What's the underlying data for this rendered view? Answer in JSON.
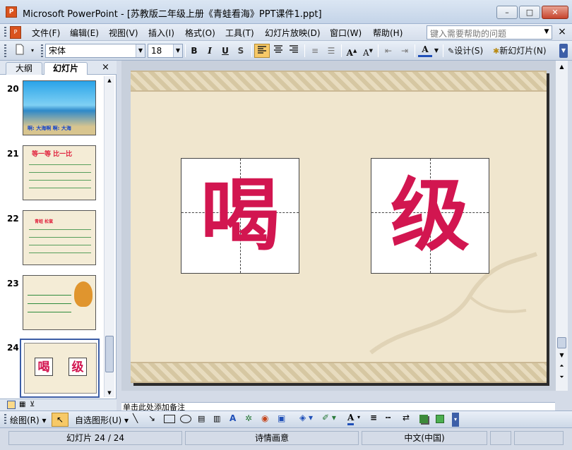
{
  "window": {
    "title": "Microsoft PowerPoint - [苏教版二年级上册《青蛙看海》PPT课件1.ppt]",
    "app_icon_text": "P",
    "min_symbol": "–",
    "max_symbol": "□",
    "close_symbol": "✕"
  },
  "menu": {
    "items": [
      "文件(F)",
      "编辑(E)",
      "视图(V)",
      "插入(I)",
      "格式(O)",
      "工具(T)",
      "幻灯片放映(D)",
      "窗口(W)",
      "帮助(H)"
    ],
    "help_placeholder": "键入需要帮助的问题",
    "close_symbol": "×"
  },
  "toolbar": {
    "font_name": "宋体",
    "font_size": "18",
    "bold": "B",
    "italic": "I",
    "underline": "U",
    "shadow": "S",
    "font_color_label": "A",
    "design_label": "设计(S)",
    "new_slide_label": "新幻灯片(N)"
  },
  "left_panel": {
    "tabs": [
      "大纲",
      "幻灯片"
    ],
    "close_symbol": "×",
    "slides": [
      {
        "number": "20",
        "caption": "啊: 大海啊      啊: 大海"
      },
      {
        "number": "21",
        "caption": "等一等 比一比"
      },
      {
        "number": "22",
        "caption": "青蛙 松鼠"
      },
      {
        "number": "23",
        "caption": ""
      },
      {
        "number": "24",
        "caption": ""
      }
    ],
    "thumb24_chars": [
      "喝",
      "级"
    ]
  },
  "slide": {
    "characters": [
      "喝",
      "级"
    ],
    "accent_color": "#d21650"
  },
  "notes": {
    "placeholder": "单击此处添加备注"
  },
  "drawing_toolbar": {
    "draw_label": "绘图(R)",
    "autoshape_label": "自选图形(U)"
  },
  "status": {
    "slide_info": "幻灯片 24 / 24",
    "design": "诗情画意",
    "language": "中文(中国)"
  },
  "icons": {
    "new_doc": "new-document-icon",
    "align_left": "align-left-icon",
    "align_center": "align-center-icon",
    "align_right": "align-right-icon",
    "numbering": "numbering-icon",
    "bullets": "bullets-icon",
    "font_grow": "font-grow-icon",
    "font_shrink": "font-shrink-icon"
  }
}
